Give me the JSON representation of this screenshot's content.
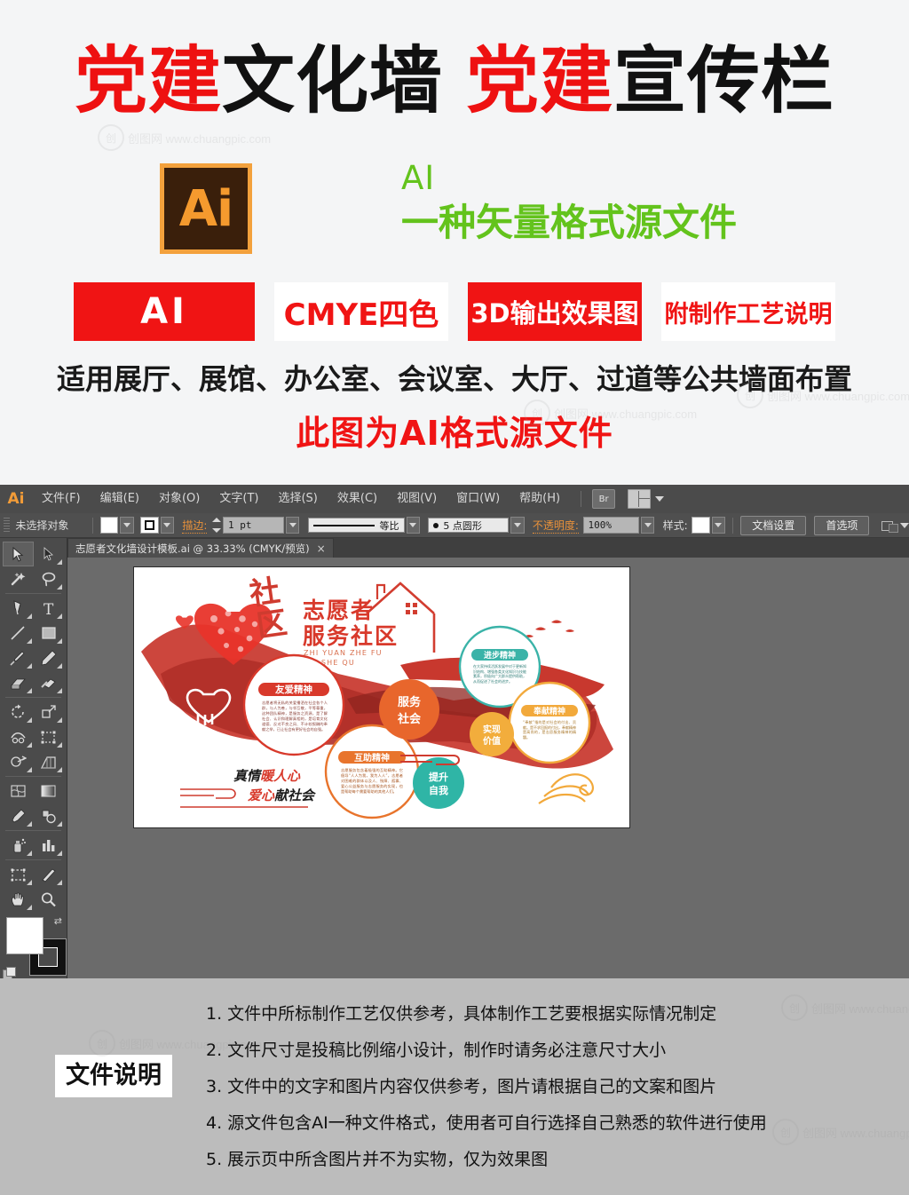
{
  "promo": {
    "title_parts": [
      {
        "text": "党建",
        "color": "#ee1111"
      },
      {
        "text": "文化墙",
        "color": "#111111"
      },
      {
        "text": "党建",
        "color": "#ee1111"
      },
      {
        "text": "宣传栏",
        "color": "#111111"
      }
    ],
    "title_full": "党建文化墙 党建宣传栏",
    "ai_logo_text": "Ai",
    "ai_green_line1": "AI",
    "ai_green_line2": "一种矢量格式源文件",
    "badges": [
      {
        "label": "AI",
        "bg": "#f01414",
        "fg": "#ffffff"
      },
      {
        "label": "CMYE四色",
        "bg": "#ffffff",
        "fg": "#f01414"
      },
      {
        "label": "3D输出效果图",
        "bg": "#f01414",
        "fg": "#ffffff"
      },
      {
        "label": "附制作工艺说明",
        "bg": "#ffffff",
        "fg": "#f01414"
      }
    ],
    "subtitle": "适用展厅、展馆、办公室、会议室、大厅、过道等公共墙面布置",
    "note": "此图为AI格式源文件",
    "watermark": "创图网  www.chuangpic.com"
  },
  "app": {
    "name": "Ai",
    "menus": [
      {
        "label": "文件(F)"
      },
      {
        "label": "编辑(E)"
      },
      {
        "label": "对象(O)"
      },
      {
        "label": "文字(T)"
      },
      {
        "label": "选择(S)"
      },
      {
        "label": "效果(C)"
      },
      {
        "label": "视图(V)"
      },
      {
        "label": "窗口(W)"
      },
      {
        "label": "帮助(H)"
      }
    ],
    "bridge_label": "Br",
    "control": {
      "selection_status": "未选择对象",
      "stroke_label": "描边:",
      "stroke_weight": "1 pt",
      "stroke_profile": "等比",
      "brush": "5 点圆形",
      "opacity_label": "不透明度:",
      "opacity_value": "100%",
      "style_label": "样式:",
      "doc_setup_button": "文档设置",
      "preferences_button": "首选项"
    },
    "document_tab": {
      "title": "志愿者文化墙设计模板.ai @ 33.33% (CMYK/预览)",
      "close": "×"
    },
    "tools": [
      {
        "name": "selection-tool",
        "selected": true
      },
      {
        "name": "direct-selection-tool",
        "selected": false
      },
      {
        "name": "magic-wand-tool",
        "selected": false
      },
      {
        "name": "lasso-tool",
        "selected": false
      },
      {
        "name": "pen-tool",
        "selected": false
      },
      {
        "name": "type-tool",
        "selected": false
      },
      {
        "name": "line-segment-tool",
        "selected": false
      },
      {
        "name": "rectangle-tool",
        "selected": false
      },
      {
        "name": "paintbrush-tool",
        "selected": false
      },
      {
        "name": "pencil-tool",
        "selected": false
      },
      {
        "name": "blob-brush-tool",
        "selected": false
      },
      {
        "name": "eraser-tool",
        "selected": false
      },
      {
        "name": "rotate-tool",
        "selected": false
      },
      {
        "name": "scale-tool",
        "selected": false
      },
      {
        "name": "width-tool",
        "selected": false
      },
      {
        "name": "free-transform-tool",
        "selected": false
      },
      {
        "name": "shape-builder-tool",
        "selected": false
      },
      {
        "name": "perspective-grid-tool",
        "selected": false
      },
      {
        "name": "mesh-tool",
        "selected": false
      },
      {
        "name": "gradient-tool",
        "selected": false
      },
      {
        "name": "eyedropper-tool",
        "selected": false
      },
      {
        "name": "blend-tool",
        "selected": false
      },
      {
        "name": "symbol-sprayer-tool",
        "selected": false
      },
      {
        "name": "column-graph-tool",
        "selected": false
      },
      {
        "name": "artboard-tool",
        "selected": false
      },
      {
        "name": "slice-tool",
        "selected": false
      },
      {
        "name": "hand-tool",
        "selected": false
      },
      {
        "name": "zoom-tool",
        "selected": false
      }
    ]
  },
  "artwork": {
    "main_title_line1": "志愿者",
    "main_title_line2": "服务社区",
    "calligraphy": "社区",
    "pinyin_line1": "ZHI YUAN ZHE FU",
    "pinyin_line2": "WU SHE QU",
    "slogan_line1": "真情暖人心",
    "slogan_line2": "爱心献社会",
    "center_circle": "服务\n社会",
    "circles": [
      {
        "title": "友爱精神",
        "color": "#d8392b",
        "type": "ring",
        "body": "志愿者将无私的关爱播洒在社会各个人群，与人为善，与邻互敬，平等尊重，这种团队精神，是服务之资源，是了解社会、认识和理解真相的，是培育文化道德、反对不良之风、不计较报酬的奉献之举，已让社会有更好社会的自强。"
      },
      {
        "title": "进步精神",
        "color": "#3ab3a8",
        "type": "ring",
        "body": "在大家持续活跃发展中对于更新知识结构、增强各类文化知识与技能素养，积极向广大群众提供帮助，从而促进了社会的进步。"
      },
      {
        "title": "奉献精神",
        "color": "#f2a93b",
        "type": "ring",
        "body": "\"奉献\"指的是对社会的付出、贡献。是不求回报的付出，奉献精神是高尚的，是志愿服务精神的精髓。"
      },
      {
        "title": "互助精神",
        "color": "#e8742c",
        "type": "ring",
        "body": "志愿服务包含着极强的互助精神。它倡导\"人人为我，我为人人\"，志愿者对困难的群体以及人、残障、孤寡、爱心公益服务与志愿服务的实现，也是帮助每个需要帮助的其他人们。"
      },
      {
        "title": "服务社会",
        "color": "#e8662c",
        "type": "solid"
      },
      {
        "title": "实现价值",
        "color": "#f2ad3c",
        "type": "solid"
      },
      {
        "title": "提升自我",
        "color": "#2fb5a6",
        "type": "solid"
      }
    ]
  },
  "footer": {
    "label": "文件说明",
    "notes": [
      "1. 文件中所标制作工艺仅供参考，具体制作工艺要根据实际情况制定",
      "2. 文件尺寸是投稿比例缩小设计，制作时请务必注意尺寸大小",
      "3. 文件中的文字和图片内容仅供参考，图片请根据自己的文案和图片",
      "4. 源文件包含AI一种文件格式，使用者可自行选择自己熟悉的软件进行使用",
      "5. 展示页中所含图片并不为实物，仅为效果图"
    ]
  }
}
